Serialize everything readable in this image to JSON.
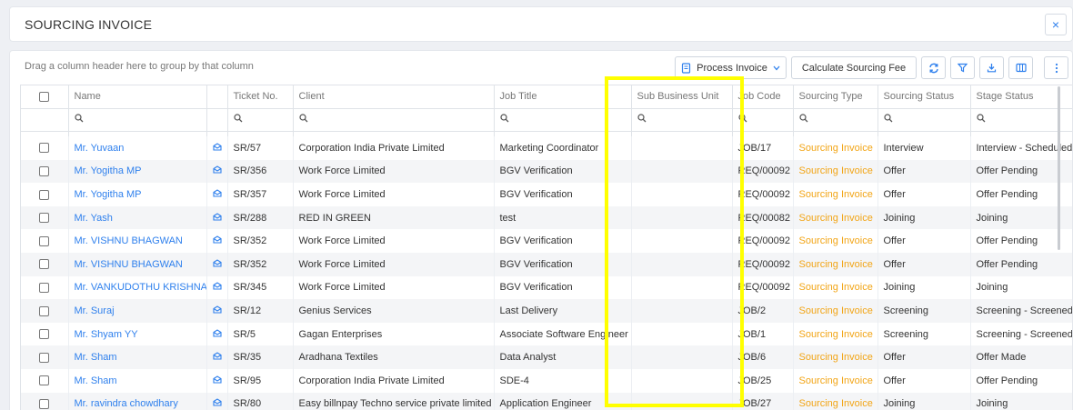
{
  "header": {
    "title": "SOURCING INVOICE",
    "close_label": "×"
  },
  "grid": {
    "group_hint": "Drag a column header here to group by that column",
    "toolbar": {
      "process_invoice": "Process Invoice",
      "calculate_fee": "Calculate Sourcing Fee"
    },
    "columns": [
      "",
      "Name",
      "",
      "Ticket No.",
      "Client",
      "Job Title",
      "Sub Business Unit",
      "Job Code",
      "Sourcing Type",
      "Sourcing Status",
      "Stage Status"
    ],
    "rows": [
      {
        "name": "Mr. Yuvaan",
        "ticket": "SR/57",
        "client": "Corporation India Private Limited",
        "job_title": "Marketing Coordinator",
        "sbu": "",
        "job_code": "JOB/17",
        "sourcing_type": "Sourcing Invoice",
        "sourcing_status": "Interview",
        "stage_status": "Interview - Scheduled"
      },
      {
        "name": "Mr. Yogitha MP",
        "ticket": "SR/356",
        "client": "Work Force Limited",
        "job_title": "BGV Verification",
        "sbu": "",
        "job_code": "REQ/00092",
        "sourcing_type": "Sourcing Invoice",
        "sourcing_status": "Offer",
        "stage_status": "Offer Pending"
      },
      {
        "name": "Mr. Yogitha MP",
        "ticket": "SR/357",
        "client": "Work Force Limited",
        "job_title": "BGV Verification",
        "sbu": "",
        "job_code": "REQ/00092",
        "sourcing_type": "Sourcing Invoice",
        "sourcing_status": "Offer",
        "stage_status": "Offer Pending"
      },
      {
        "name": "Mr. Yash",
        "ticket": "SR/288",
        "client": "RED IN GREEN",
        "job_title": "test",
        "sbu": "",
        "job_code": "REQ/00082",
        "sourcing_type": "Sourcing Invoice",
        "sourcing_status": "Joining",
        "stage_status": "Joining"
      },
      {
        "name": "Mr. VISHNU BHAGWAN",
        "ticket": "SR/352",
        "client": "Work Force Limited",
        "job_title": "BGV Verification",
        "sbu": "",
        "job_code": "REQ/00092",
        "sourcing_type": "Sourcing Invoice",
        "sourcing_status": "Offer",
        "stage_status": "Offer Pending"
      },
      {
        "name": "Mr. VISHNU BHAGWAN",
        "ticket": "SR/352",
        "client": "Work Force Limited",
        "job_title": "BGV Verification",
        "sbu": "",
        "job_code": "REQ/00092",
        "sourcing_type": "Sourcing Invoice",
        "sourcing_status": "Offer",
        "stage_status": "Offer Pending"
      },
      {
        "name": "Mr. VANKUDOTHU KRISHNA",
        "ticket": "SR/345",
        "client": "Work Force Limited",
        "job_title": "BGV Verification",
        "sbu": "",
        "job_code": "REQ/00092",
        "sourcing_type": "Sourcing Invoice",
        "sourcing_status": "Joining",
        "stage_status": "Joining"
      },
      {
        "name": "Mr. Suraj",
        "ticket": "SR/12",
        "client": "Genius Services",
        "job_title": "Last Delivery",
        "sbu": "",
        "job_code": "JOB/2",
        "sourcing_type": "Sourcing Invoice",
        "sourcing_status": "Screening",
        "stage_status": "Screening - Screened"
      },
      {
        "name": "Mr. Shyam YY",
        "ticket": "SR/5",
        "client": "Gagan Enterprises",
        "job_title": "Associate Software Engineer",
        "sbu": "",
        "job_code": "JOB/1",
        "sourcing_type": "Sourcing Invoice",
        "sourcing_status": "Screening",
        "stage_status": "Screening - Screened"
      },
      {
        "name": "Mr. Sham",
        "ticket": "SR/35",
        "client": "Aradhana Textiles",
        "job_title": "Data Analyst",
        "sbu": "",
        "job_code": "JOB/6",
        "sourcing_type": "Sourcing Invoice",
        "sourcing_status": "Offer",
        "stage_status": "Offer Made"
      },
      {
        "name": "Mr. Sham",
        "ticket": "SR/95",
        "client": "Corporation India Private Limited",
        "job_title": "SDE-4",
        "sbu": "",
        "job_code": "JOB/25",
        "sourcing_type": "Sourcing Invoice",
        "sourcing_status": "Offer",
        "stage_status": "Offer Pending"
      },
      {
        "name": "Mr. ravindra chowdhary",
        "ticket": "SR/80",
        "client": "Easy billnpay Techno service private limited",
        "job_title": "Application Engineer",
        "sbu": "",
        "job_code": "JOB/27",
        "sourcing_type": "Sourcing Invoice",
        "sourcing_status": "Joining",
        "stage_status": "Joining"
      }
    ]
  },
  "colors": {
    "link": "#2f80ed",
    "sourcing_type": "#f2a516",
    "highlight": "#ffff00"
  },
  "icons": [
    "close-icon",
    "invoice-icon",
    "chevron-down-icon",
    "refresh-icon",
    "filter-icon",
    "download-icon",
    "columns-icon",
    "more-vertical-icon",
    "search-icon",
    "mail-icon"
  ]
}
